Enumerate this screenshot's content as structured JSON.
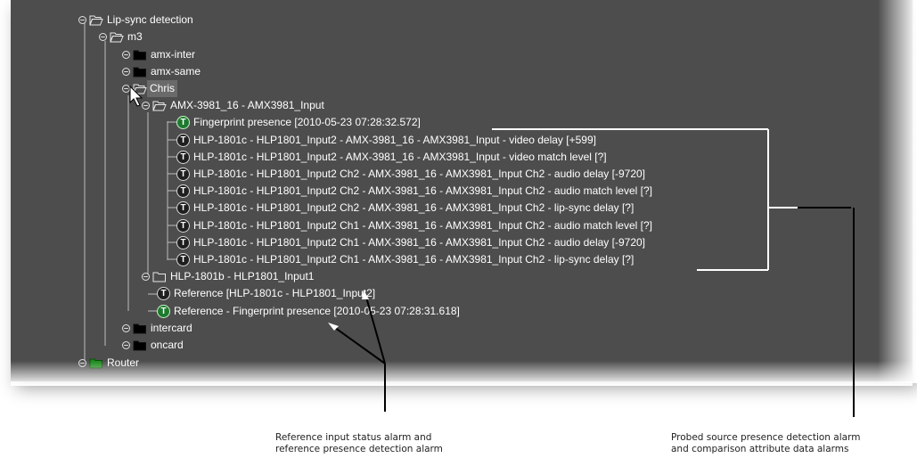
{
  "tree": {
    "nodes": [
      {
        "label": "Lip-sync detection",
        "icon": "folder-open-icon"
      },
      {
        "label": "m3",
        "icon": "folder-open-icon"
      },
      {
        "label": "amx-inter",
        "icon": "folder-closed-icon"
      },
      {
        "label": "amx-same",
        "icon": "folder-closed-icon"
      },
      {
        "label": "Chris",
        "icon": "folder-open-icon"
      },
      {
        "label": "AMX-3981_16 - AMX3981_Input",
        "icon": "folder-open-icon"
      },
      {
        "label": "Fingerprint presence [2010-05-23 07:28:32.572]",
        "icon": "alarm-green-icon"
      },
      {
        "label": "HLP-1801c - HLP1801_Input2 - AMX-3981_16 - AMX3981_Input - video delay [+599]",
        "icon": "alarm-black-icon"
      },
      {
        "label": "HLP-1801c - HLP1801_Input2 - AMX-3981_16 - AMX3981_Input - video match level [?]",
        "icon": "alarm-black-icon"
      },
      {
        "label": "HLP-1801c - HLP1801_Input2 Ch2 - AMX-3981_16 - AMX3981_Input Ch2 - audio delay [-9720]",
        "icon": "alarm-black-icon"
      },
      {
        "label": "HLP-1801c - HLP1801_Input2 Ch2 - AMX-3981_16 - AMX3981_Input Ch2 - audio match level [?]",
        "icon": "alarm-black-icon"
      },
      {
        "label": "HLP-1801c - HLP1801_Input2 Ch2 - AMX-3981_16 - AMX3981_Input Ch2 - lip-sync delay [?]",
        "icon": "alarm-black-icon"
      },
      {
        "label": "HLP-1801c - HLP1801_Input2 Ch1 - AMX-3981_16 - AMX3981_Input Ch2 - audio match level [?]",
        "icon": "alarm-black-icon"
      },
      {
        "label": "HLP-1801c - HLP1801_Input2 Ch1 - AMX-3981_16 - AMX3981_Input Ch2 - audio delay [-9720]",
        "icon": "alarm-black-icon"
      },
      {
        "label": "HLP-1801c - HLP1801_Input2 Ch1 - AMX-3981_16 - AMX3981_Input Ch2 - lip-sync delay [?]",
        "icon": "alarm-black-icon"
      },
      {
        "label": "HLP-1801b - HLP1801_Input1",
        "icon": "folder-empty-icon"
      },
      {
        "label": "Reference [HLP-1801c - HLP1801_Input2]",
        "icon": "alarm-black-icon"
      },
      {
        "label": "Reference - Fingerprint presence [2010-05-23 07:28:31.618]",
        "icon": "alarm-green-icon"
      },
      {
        "label": "intercard",
        "icon": "folder-closed-icon"
      },
      {
        "label": "oncard",
        "icon": "folder-closed-icon"
      },
      {
        "label": "Router",
        "icon": "folder-green-icon"
      }
    ],
    "badge_letter": "T"
  },
  "callouts": {
    "left": [
      "Reference input status alarm and",
      "reference presence detection alarm"
    ],
    "right": [
      "Probed source presence detection alarm",
      "and comparison attribute data alarms"
    ]
  },
  "colors": {
    "panel": "#4d4d4d",
    "alarm_green": "#1e7a2e",
    "alarm_black": "#1f1f1f",
    "folder_black": "#000000",
    "folder_green": "#1a8a1a"
  }
}
